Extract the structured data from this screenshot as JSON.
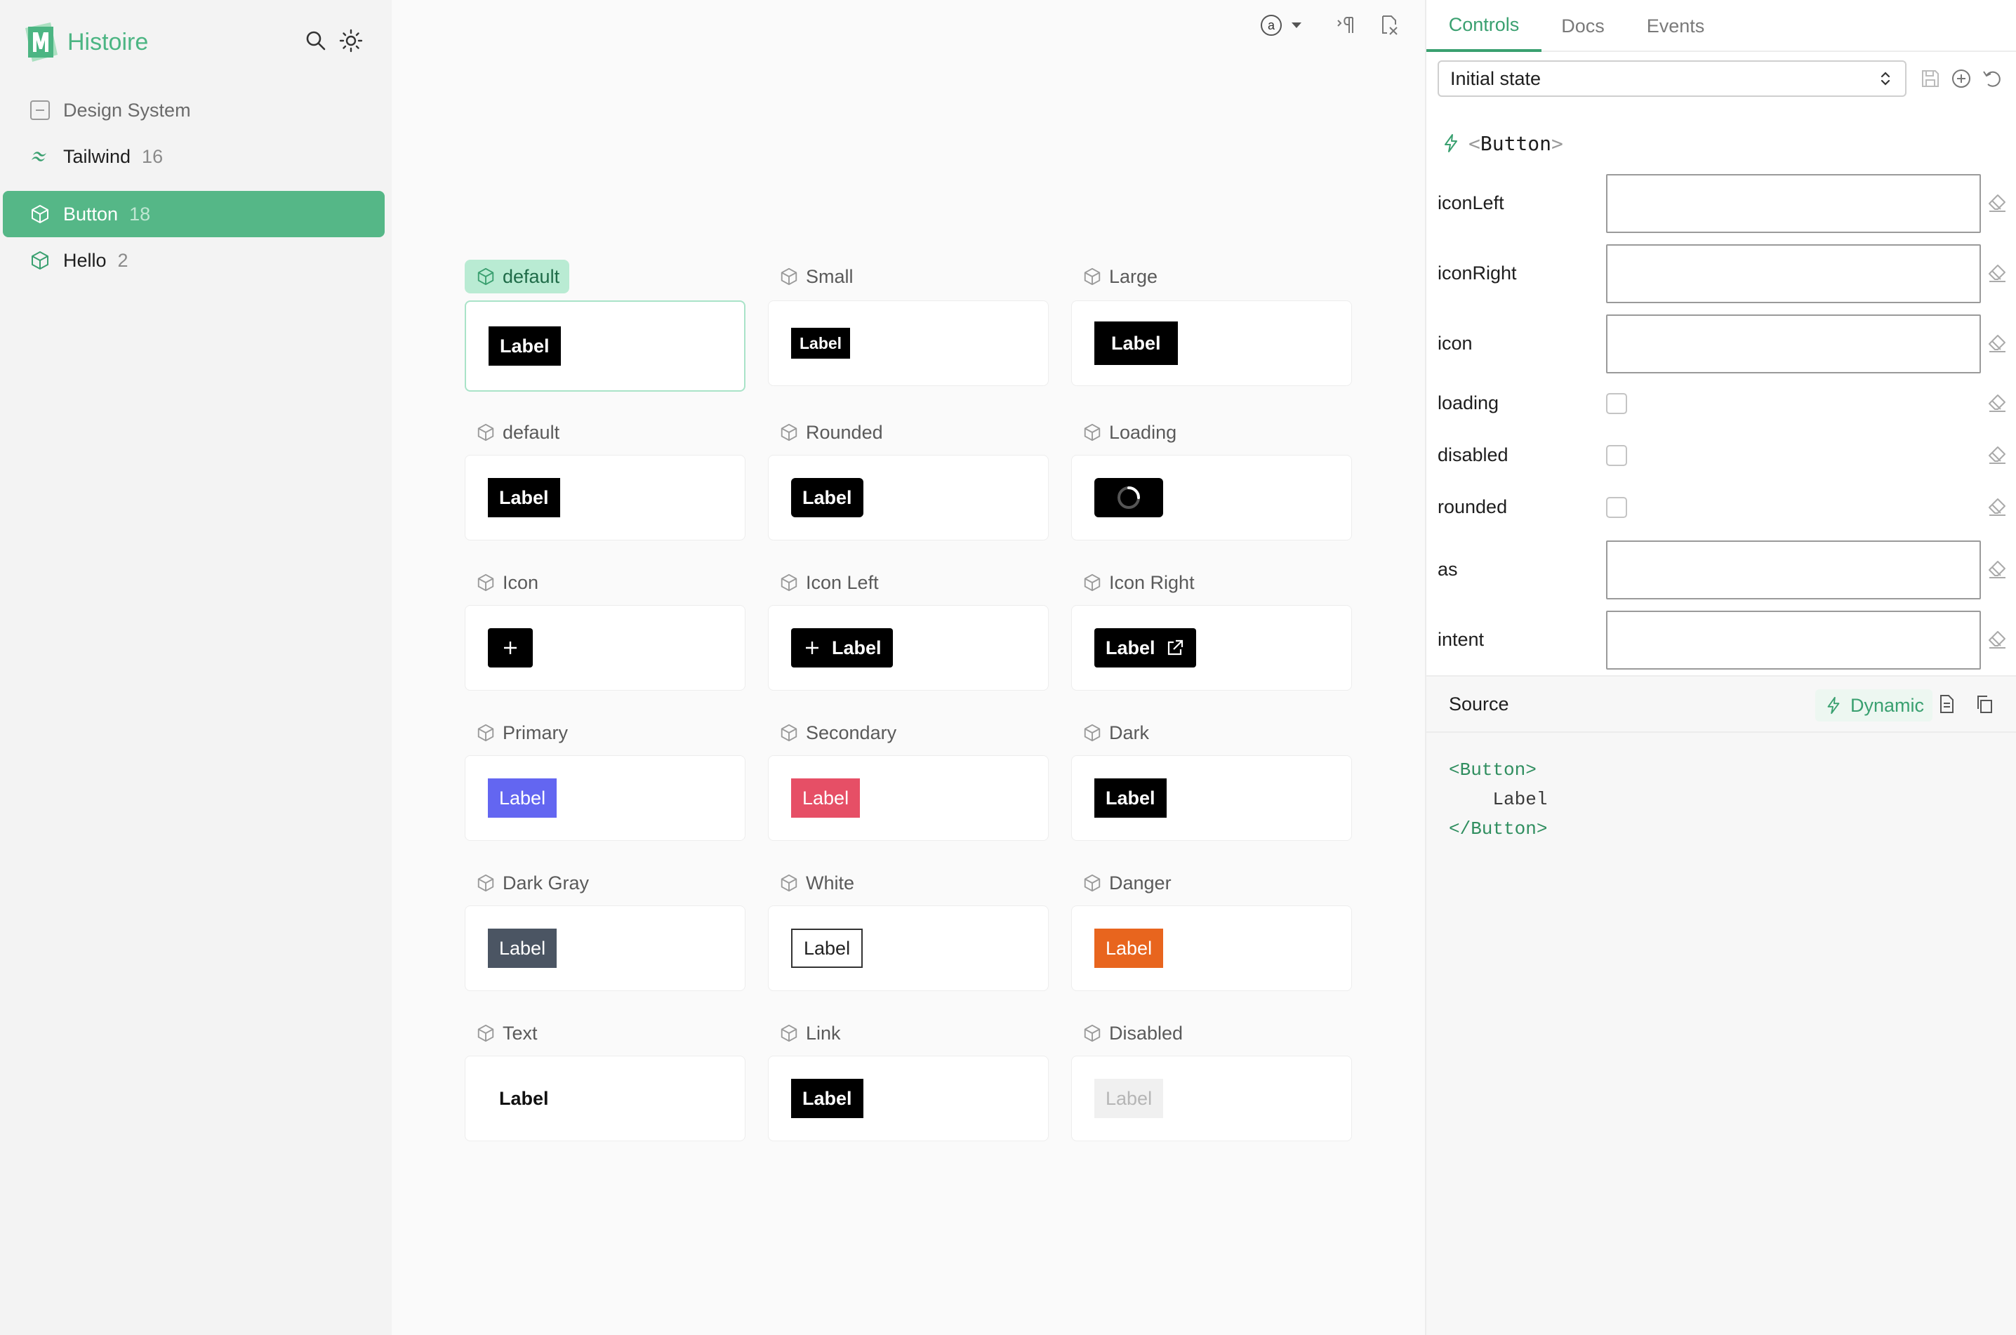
{
  "app": {
    "name": "Histoire",
    "brand_color": "#4cb583"
  },
  "sidebar": {
    "items": [
      {
        "label": "Design System",
        "count": "",
        "icon": "folder-collapse-icon"
      },
      {
        "label": "Tailwind",
        "count": "16",
        "icon": "tailwind-icon"
      },
      {
        "label": "Button",
        "count": "18",
        "icon": "cube-icon",
        "active": true
      },
      {
        "label": "Hello",
        "count": "2",
        "icon": "cube-icon"
      }
    ]
  },
  "stage": {
    "toolbar": [
      "text-direction-icon",
      "responsive-icon",
      "background-icon"
    ],
    "variants": [
      {
        "title": "default",
        "label": "Label",
        "active": true
      },
      {
        "title": "Small",
        "label": "Label"
      },
      {
        "title": "Large",
        "label": "Label"
      },
      {
        "title": "default",
        "label": "Label"
      },
      {
        "title": "Rounded",
        "label": "Label"
      },
      {
        "title": "Loading",
        "label": ""
      },
      {
        "title": "Icon",
        "label": ""
      },
      {
        "title": "Icon Left",
        "label": "Label"
      },
      {
        "title": "Icon Right",
        "label": "Label"
      },
      {
        "title": "Primary",
        "label": "Label",
        "color": "#6366f1"
      },
      {
        "title": "Secondary",
        "label": "Label",
        "color": "#e64f66"
      },
      {
        "title": "Dark",
        "label": "Label",
        "color": "#000000"
      },
      {
        "title": "Dark Gray",
        "label": "Label",
        "color": "#4b5563"
      },
      {
        "title": "White",
        "label": "Label",
        "color": "#ffffff"
      },
      {
        "title": "Danger",
        "label": "Label",
        "color": "#e8651e"
      },
      {
        "title": "Text",
        "label": "Label"
      },
      {
        "title": "Link",
        "label": "Label",
        "color": "#000000"
      },
      {
        "title": "Disabled",
        "label": "Label",
        "color": "#f0f0f0"
      }
    ]
  },
  "pane": {
    "tabs": [
      "Controls",
      "Docs",
      "Events"
    ],
    "active_tab": "Controls",
    "state_select": "Initial state",
    "component": {
      "open": "<",
      "name": "Button",
      "close": ">"
    },
    "controls": [
      {
        "label": "iconLeft",
        "type": "text",
        "value": ""
      },
      {
        "label": "iconRight",
        "type": "text",
        "value": ""
      },
      {
        "label": "icon",
        "type": "text",
        "value": ""
      },
      {
        "label": "loading",
        "type": "checkbox",
        "checked": false
      },
      {
        "label": "disabled",
        "type": "checkbox",
        "checked": false
      },
      {
        "label": "rounded",
        "type": "checkbox",
        "checked": false
      },
      {
        "label": "as",
        "type": "text",
        "value": ""
      },
      {
        "label": "intent",
        "type": "text",
        "value": ""
      }
    ],
    "source": {
      "label": "Source",
      "mode": "Dynamic",
      "code": {
        "open": "<Button>",
        "body": "Label",
        "close": "</Button>"
      }
    }
  }
}
